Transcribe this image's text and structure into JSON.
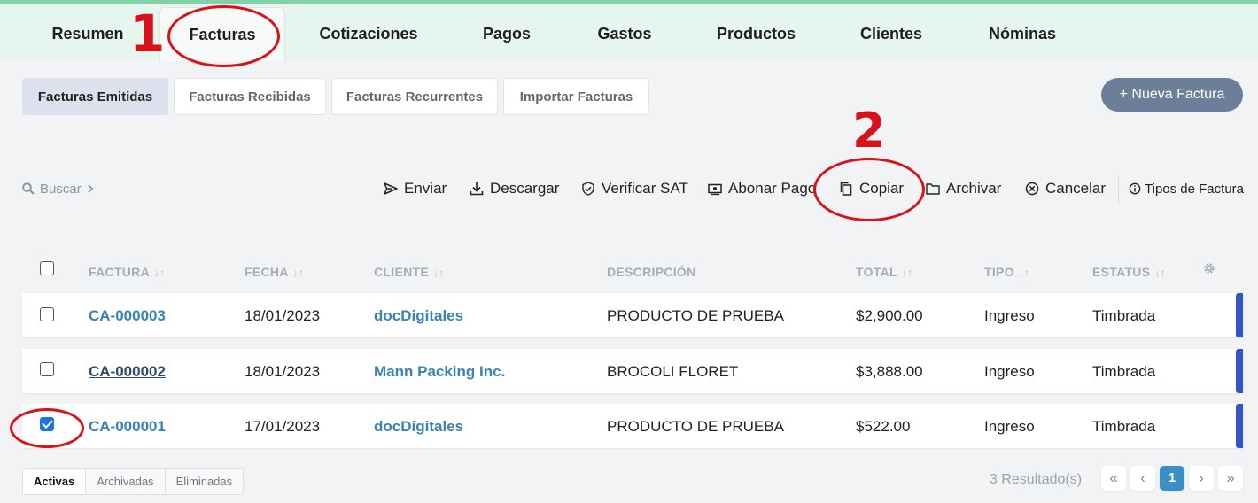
{
  "nav": {
    "tabs": [
      {
        "label": "Resumen"
      },
      {
        "label": "Facturas"
      },
      {
        "label": "Cotizaciones"
      },
      {
        "label": "Pagos"
      },
      {
        "label": "Gastos"
      },
      {
        "label": "Productos"
      },
      {
        "label": "Clientes"
      },
      {
        "label": "Nóminas"
      }
    ],
    "active": "Facturas"
  },
  "subtabs": [
    {
      "label": "Facturas Emitidas"
    },
    {
      "label": "Facturas Recibidas"
    },
    {
      "label": "Facturas Recurrentes"
    },
    {
      "label": "Importar Facturas"
    }
  ],
  "new_button": {
    "icon": "+",
    "label": "Nueva Factura"
  },
  "search": {
    "label": "Buscar",
    "icon": "search-icon"
  },
  "actions": [
    {
      "label": "Enviar",
      "icon": "send-icon"
    },
    {
      "label": "Descargar",
      "icon": "download-icon"
    },
    {
      "label": "Verificar SAT",
      "icon": "shield-check-icon"
    },
    {
      "label": "Abonar Pago",
      "icon": "payment-icon"
    },
    {
      "label": "Copiar",
      "icon": "copy-icon"
    },
    {
      "label": "Archivar",
      "icon": "folder-icon"
    },
    {
      "label": "Cancelar",
      "icon": "cancel-circle-icon"
    },
    {
      "label": "Tipos de Factura",
      "icon": "info-icon"
    }
  ],
  "table": {
    "columns": [
      "FACTURA",
      "FECHA",
      "CLIENTE",
      "DESCRIPCIÓN",
      "TOTAL",
      "TIPO",
      "ESTATUS"
    ],
    "rows": [
      {
        "factura": "CA-000003",
        "fecha": "18/01/2023",
        "cliente": "docDigitales",
        "descripcion": "PRODUCTO DE PRUEBA",
        "total": "$2,900.00",
        "tipo": "Ingreso",
        "estatus": "Timbrada",
        "checked": false
      },
      {
        "factura": "CA-000002",
        "fecha": "18/01/2023",
        "cliente": "Mann Packing Inc.",
        "descripcion": "BROCOLI FLORET",
        "total": "$3,888.00",
        "tipo": "Ingreso",
        "estatus": "Timbrada",
        "checked": false
      },
      {
        "factura": "CA-000001",
        "fecha": "17/01/2023",
        "cliente": "docDigitales",
        "descripcion": "PRODUCTO DE PRUEBA",
        "total": "$522.00",
        "tipo": "Ingreso",
        "estatus": "Timbrada",
        "checked": true
      }
    ]
  },
  "status_tabs": [
    {
      "label": "Activas"
    },
    {
      "label": "Archivadas"
    },
    {
      "label": "Eliminadas"
    }
  ],
  "pagination": {
    "results": "3 Resultado(s)",
    "current_page": "1",
    "first": "«",
    "prev": "‹",
    "next": "›",
    "last": "»"
  },
  "annotations": {
    "step1": "1",
    "step2": "2"
  },
  "colors": {
    "annotation": "#d8111a",
    "accent": "#3b82b5",
    "row_edge": "#3154c9"
  }
}
